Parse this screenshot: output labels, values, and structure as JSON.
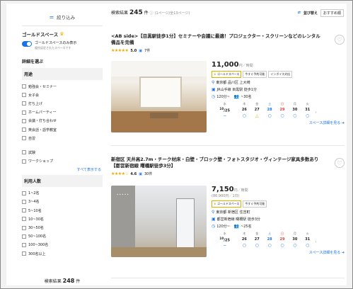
{
  "sidebar": {
    "filter_label": "絞り込み",
    "gold_label": "ゴールドスペース",
    "gold_toggle_text": "ゴールドスペースのみ表示",
    "gold_toggle_sub": "優良認定されたスペースです",
    "details_heading": "詳細を選ぶ",
    "purpose_heading": "用途",
    "purposes": [
      "勉強会・セミナー",
      "女子会",
      "打ち上げ",
      "ホームパーティー",
      "会議・打ち合わせ",
      "英会話・語学教室",
      "自習",
      "",
      "試験",
      "ワークショップ"
    ],
    "show_all": "すべて表示する",
    "people_heading": "利用人数",
    "people": [
      "1~2名",
      "3~4名",
      "5~10名",
      "10~30名",
      "30~50名",
      "50~100名",
      "100~300名",
      "300名以上"
    ],
    "result_prefix": "検索結果",
    "result_count": "248",
    "result_suffix": "件"
  },
  "header": {
    "result_prefix": "検索結果",
    "result_count": "245",
    "result_suffix": "件",
    "page_info": "(1ページ/全13ページ)",
    "sort_label": "並び替え",
    "sort_value": "おすすめ順"
  },
  "listings": [
    {
      "title": "<AB side>【目黒駅徒歩1分】セミナーや会議に最適！プロジェクター・スクリーンなどのレンタル備品を完備",
      "stars": "★★★★★",
      "rating": "5.0",
      "reviews": "7件",
      "price": "11,000",
      "price_unit": "円／時間",
      "price_sub": "",
      "tags": [
        "ゴールドスペース",
        "今すぐ予約可能",
        "インボイス対応"
      ],
      "address": "東京都 品川区 上大崎",
      "station": "JR山手線 目黒駅 徒歩1分",
      "capacity": "120分~",
      "people": "~30名",
      "days": [
        "水",
        "木",
        "金",
        "土",
        "日",
        "月",
        "火"
      ],
      "dates": [
        "25",
        "26",
        "27",
        "28",
        "29",
        "30",
        "31"
      ],
      "month": "10",
      "avail": [
        "−",
        "○",
        "△",
        "○",
        "○",
        "○",
        "○"
      ],
      "more": "スペース詳細を見る"
    },
    {
      "title": "新宿区 天井高2.7m・チーク材床・白壁・ブロック壁・フォトスタジオ・ヴィンテージ家具多数あり【都営新宿線 曙橋駅徒歩3分】",
      "stars": "★★★★☆",
      "rating": "4.6",
      "reviews": "30件",
      "price": "7,150",
      "price_unit": "円／時間",
      "price_sub": "(86,900円／1日)",
      "tags": [
        "ゴールドスペース",
        "今すぐ予約可能"
      ],
      "address": "東京都 新宿区 住吉町",
      "station": "都営新宿線 曙橋駅 徒歩3分",
      "capacity": "120分~",
      "people": "~25名",
      "days": [
        "水",
        "木",
        "金",
        "土",
        "日",
        "月",
        "火"
      ],
      "dates": [
        "25",
        "26",
        "27",
        "28",
        "29",
        "30",
        "31"
      ],
      "month": "10",
      "avail": [
        "−",
        "○",
        "○",
        "○",
        "○",
        "○",
        "○"
      ],
      "more": "スペース詳細を見る"
    }
  ],
  "colors": {
    "accent": "#1a73e8",
    "star": "#f5a400",
    "gold": "#e0b000"
  }
}
